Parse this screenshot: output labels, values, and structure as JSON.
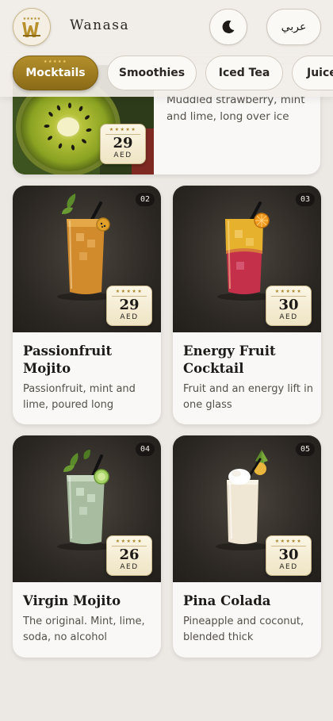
{
  "header": {
    "brand": "Wanasa",
    "language_button": "عربي"
  },
  "categories": [
    {
      "label": "Mocktails",
      "active": true
    },
    {
      "label": "Smoothies",
      "active": false
    },
    {
      "label": "Iced Tea",
      "active": false
    },
    {
      "label": "Juice",
      "active": false
    }
  ],
  "featured": {
    "description": "Muddled strawberry, mint and lime, long over ice",
    "price": "29",
    "currency": "AED"
  },
  "products": [
    {
      "number": "02",
      "name": "Passionfruit Mojito",
      "description": "Passionfruit, mint and lime, poured long",
      "price": "29",
      "currency": "AED"
    },
    {
      "number": "03",
      "name": "Energy Fruit Cocktail",
      "description": "Fruit and an energy lift in one glass",
      "price": "30",
      "currency": "AED"
    },
    {
      "number": "04",
      "name": "Virgin Mojito",
      "description": "The original. Mint, lime, soda, no alcohol",
      "price": "26",
      "currency": "AED"
    },
    {
      "number": "05",
      "name": "Pina Colada",
      "description": "Pineapple and coconut, blended thick",
      "price": "30",
      "currency": "AED"
    }
  ],
  "icons": {
    "logo": "wanasa-logo-icon",
    "theme": "moon-icon"
  },
  "colors": {
    "accent_gold": "#a8852a",
    "background": "#ece8e3"
  }
}
